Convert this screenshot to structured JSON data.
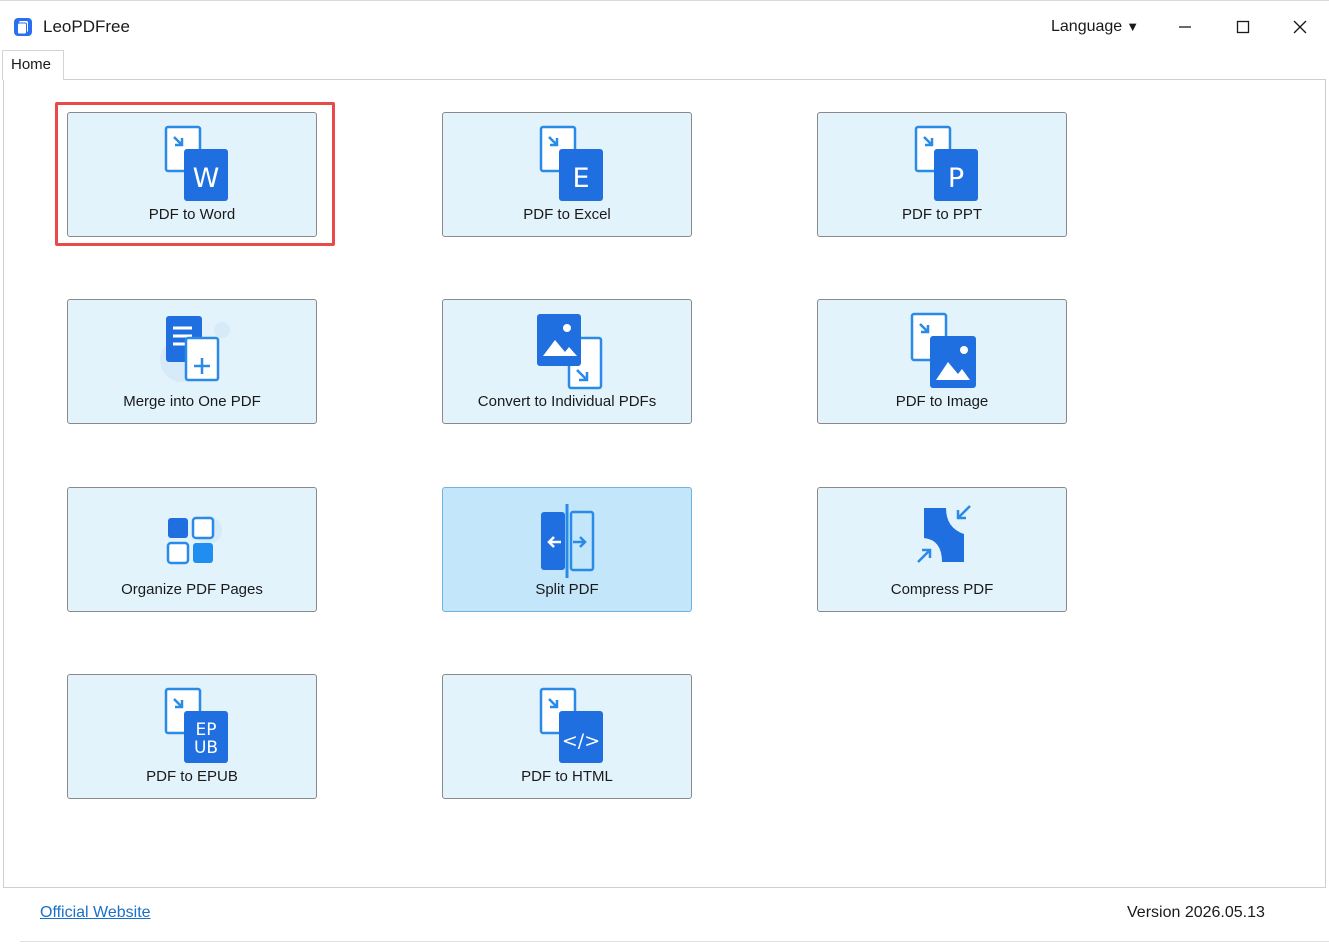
{
  "window": {
    "title": "LeoPDFree",
    "language_label": "Language",
    "language_arrow": "▼"
  },
  "tabs": [
    {
      "label": "Home"
    }
  ],
  "tiles": [
    {
      "label": "PDF to Word",
      "icon": "pdf-to-word-icon",
      "letter": "W"
    },
    {
      "label": "PDF to Excel",
      "icon": "pdf-to-excel-icon",
      "letter": "E"
    },
    {
      "label": "PDF to PPT",
      "icon": "pdf-to-ppt-icon",
      "letter": "P"
    },
    {
      "label": "Merge into One PDF",
      "icon": "merge-pdf-icon"
    },
    {
      "label": "Convert to Individual PDFs",
      "icon": "convert-individual-icon"
    },
    {
      "label": "PDF to Image",
      "icon": "pdf-to-image-icon"
    },
    {
      "label": "Organize PDF Pages",
      "icon": "organize-pages-icon"
    },
    {
      "label": "Split PDF",
      "icon": "split-pdf-icon"
    },
    {
      "label": "Compress PDF",
      "icon": "compress-pdf-icon"
    },
    {
      "label": "PDF to EPUB",
      "icon": "pdf-to-epub-icon",
      "letter": "EPUB"
    },
    {
      "label": "PDF to HTML",
      "icon": "pdf-to-html-icon",
      "letter": "</>"
    }
  ],
  "footer": {
    "link": "Official Website",
    "version": "Version 2026.05.13"
  },
  "colors": {
    "tile_bg": "#e3f3fb",
    "tile_hover_bg": "#c3e6fb",
    "icon_blue": "#1f6fe0",
    "highlight_red": "#e84a4a",
    "link_blue": "#1a6fc9"
  }
}
